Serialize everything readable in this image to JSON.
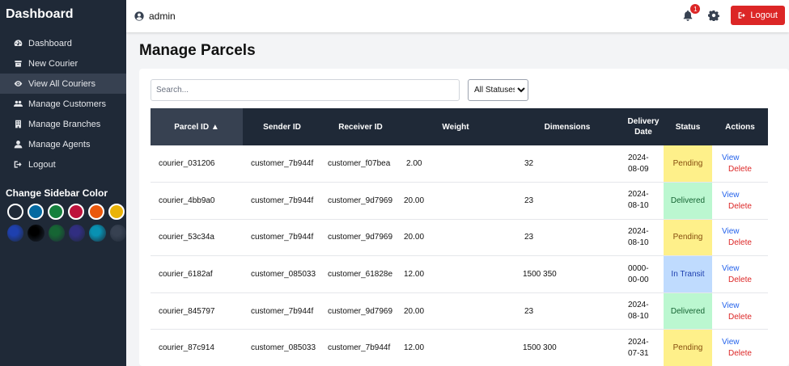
{
  "sidebar": {
    "title": "Dashboard",
    "items": [
      {
        "label": "Dashboard",
        "icon": "gauge-icon"
      },
      {
        "label": "New Courier",
        "icon": "box-icon"
      },
      {
        "label": "View All Couriers",
        "icon": "eye-icon"
      },
      {
        "label": "Manage Customers",
        "icon": "users-icon"
      },
      {
        "label": "Manage Branches",
        "icon": "building-icon"
      },
      {
        "label": "Manage Agents",
        "icon": "user-icon"
      },
      {
        "label": "Logout",
        "icon": "sign-out-icon"
      }
    ],
    "color_title": "Change Sidebar Color",
    "colors_row1": [
      "#1f2937",
      "#0369a1",
      "#15803d",
      "#be123c",
      "#ea580c",
      "#eab308"
    ],
    "colors_row2": [
      "#1e40af",
      "#000000",
      "#166534",
      "#312e81",
      "#0891b2",
      "#374151"
    ]
  },
  "topbar": {
    "username": "admin",
    "notification_count": "1",
    "logout_label": "Logout"
  },
  "main": {
    "title": "Manage Parcels",
    "search_placeholder": "Search...",
    "status_filter": "All Statuses",
    "columns": [
      "Parcel ID ▲",
      "Sender ID",
      "Receiver ID",
      "Weight",
      "Dimensions",
      "Delivery Date",
      "Status",
      "Actions"
    ],
    "action_view": "View",
    "action_delete": "Delete",
    "rows": [
      {
        "parcel_id": "courier_031206",
        "sender": "customer_7b944f",
        "receiver": "customer_f07bea",
        "weight": "2.00",
        "dimensions": "32",
        "date1": "2024-",
        "date2": "08-09",
        "status": "Pending"
      },
      {
        "parcel_id": "courier_4bb9a0",
        "sender": "customer_7b944f",
        "receiver": "customer_9d7969",
        "weight": "20.00",
        "dimensions": "23",
        "date1": "2024-",
        "date2": "08-10",
        "status": "Delivered"
      },
      {
        "parcel_id": "courier_53c34a",
        "sender": "customer_7b944f",
        "receiver": "customer_9d7969",
        "weight": "20.00",
        "dimensions": "23",
        "date1": "2024-",
        "date2": "08-10",
        "status": "Pending"
      },
      {
        "parcel_id": "courier_6182af",
        "sender": "customer_085033",
        "receiver": "customer_61828e",
        "weight": "12.00",
        "dimensions": "1500 350",
        "date1": "0000-",
        "date2": "00-00",
        "status": "In Transit"
      },
      {
        "parcel_id": "courier_845797",
        "sender": "customer_7b944f",
        "receiver": "customer_9d7969",
        "weight": "20.00",
        "dimensions": "23",
        "date1": "2024-",
        "date2": "08-10",
        "status": "Delivered"
      },
      {
        "parcel_id": "courier_87c914",
        "sender": "customer_085033",
        "receiver": "customer_7b944f",
        "weight": "12.00",
        "dimensions": "1500 300",
        "date1": "2024-",
        "date2": "07-31",
        "status": "Pending"
      }
    ]
  }
}
